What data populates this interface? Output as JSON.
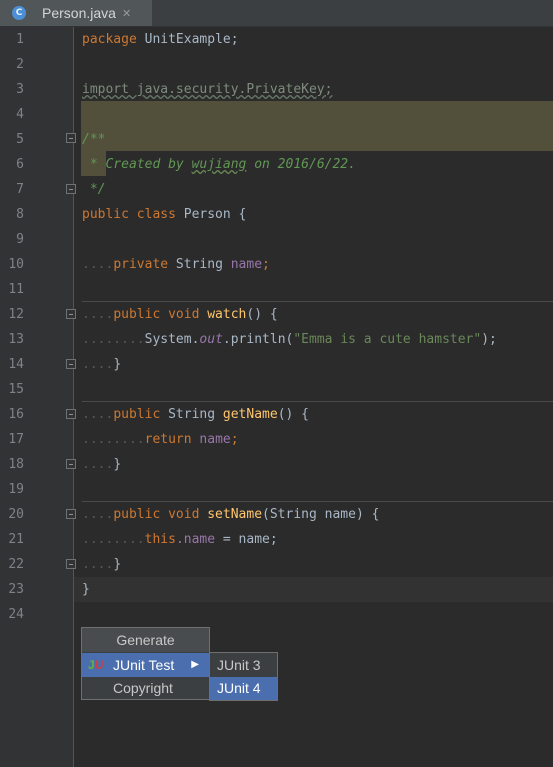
{
  "tab": {
    "icon_letter": "C",
    "file_name": "Person.java",
    "close_glyph": "✕"
  },
  "line_numbers": [
    "1",
    "2",
    "3",
    "4",
    "5",
    "6",
    "7",
    "8",
    "9",
    "10",
    "11",
    "12",
    "13",
    "14",
    "15",
    "16",
    "17",
    "18",
    "19",
    "20",
    "21",
    "22",
    "23",
    "24"
  ],
  "code": {
    "l1_kw": "package",
    "l1_rest": " UnitExample;",
    "l3": "import java.security.PrivateKey;",
    "l5": "/**",
    "l6_a": " * Created by ",
    "l6_user": "wujiang",
    "l6_b": " on 2016/6/22.",
    "l7": " */",
    "l8_kw": "public class",
    "l8_rest": " Person {",
    "l10_ws": "....",
    "l10_kw": "private",
    "l10_type": " String ",
    "l10_field": "name",
    "l10_end": ";",
    "l12_ws": "....",
    "l12_kw": "public void",
    "l12_fn": "watch",
    "l12_end": "() {",
    "l13_ws": "........",
    "l13_cls": "System.",
    "l13_static": "out",
    "l13_call": ".println(",
    "l13_str": "\"Emma is a cute hamster\"",
    "l13_end": ");",
    "l14_ws": "....",
    "l14": "}",
    "l16_ws": "....",
    "l16_kw": "public",
    "l16_type": " String ",
    "l16_fn": "getName",
    "l16_end": "() {",
    "l17_ws": "........",
    "l17_kw": "return",
    "l17_field": " name",
    "l17_end": ";",
    "l18_ws": "....",
    "l18": "}",
    "l20_ws": "....",
    "l20_kw": "public void",
    "l20_fn": "setName",
    "l20_end": "(String name) {",
    "l21_ws": "........",
    "l21_kw": "this",
    "l21_field": ".name",
    "l21_end": " = name;",
    "l22_ws": "....",
    "l22": "}",
    "l23": "}"
  },
  "generate_menu": {
    "title": "Generate",
    "items": [
      {
        "label": "JUnit Test",
        "icon_j": "J",
        "icon_u": "U",
        "arrow": "▶"
      },
      {
        "label": "Copyright"
      }
    ]
  },
  "submenu": {
    "items": [
      {
        "label": "JUnit 3"
      },
      {
        "label": "JUnit 4"
      }
    ]
  },
  "colors": {
    "background": "#2b2b2b",
    "keyword": "#cc7832",
    "selection": "#4b6eaf"
  }
}
